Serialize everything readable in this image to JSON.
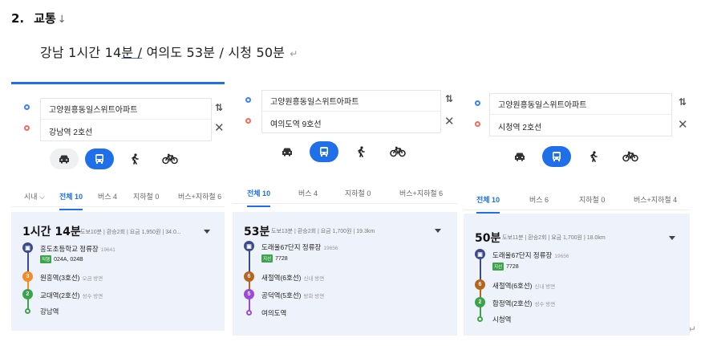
{
  "doc": {
    "heading_num": "2.",
    "heading": "교통",
    "heading_mark": "↓",
    "summary_a": "강남 1시간 14",
    "summary_b": "분 /",
    "summary_c": " 여의도 53분 / 시청 50분",
    "return_mark": "↵"
  },
  "panels": [
    {
      "origin": "고양원흥동일스위트아파트",
      "destination": "강남역 2호선",
      "swap": "⇅",
      "close": "✕",
      "tabs": [
        "시내 ⌵",
        "전체 10",
        "버스 4",
        "지하철 0",
        "버스+지하철 6"
      ],
      "time": "1시간 14분",
      "meta": "도보10분 | 환승2회 | 요금 1,950원 | 34.0...",
      "bus_stop": "흥도초등학교 정류장",
      "bus_stop_id": "19641",
      "bus_chip": "직행",
      "bus_numbers": "024A, 024B",
      "stops": [
        {
          "badge": "3",
          "name": "원흥역(3호선)",
          "dir": "오금 방면"
        },
        {
          "badge": "2",
          "name": "교대역(2호선)",
          "dir": "성수 방면"
        }
      ],
      "end": "강남역"
    },
    {
      "origin": "고양원흥동일스위트아파트",
      "destination": "여의도역 9호선",
      "swap": "⇅",
      "close": "✕",
      "tabs": [
        "전체 10",
        "버스 4",
        "지하철 0",
        "버스+지하철 6"
      ],
      "time": "53분",
      "meta": "도보13분 | 환승2회 | 요금 1,700원 | 19.3km",
      "bus_stop": "도래울67단지 정류장",
      "bus_stop_id": "19656",
      "bus_chip": "지선",
      "bus_numbers": "7728",
      "stops": [
        {
          "badge": "6",
          "name": "새절역(6호선)",
          "dir": "신내 방면"
        },
        {
          "badge": "5",
          "name": "공덕역(5호선)",
          "dir": "방화 방면"
        }
      ],
      "end": "여의도역"
    },
    {
      "origin": "고양원흥동일스위트아파트",
      "destination": "시청역 2호선",
      "swap": "⇅",
      "close": "✕",
      "tabs": [
        "전체 10",
        "버스 6",
        "지하철 0",
        "버스+지하철 4"
      ],
      "time": "50분",
      "meta": "도보11분 | 환승2회 | 요금 1,700원 | 18.0km",
      "bus_stop": "도래울67단지 정류장",
      "bus_stop_id": "19656",
      "bus_chip": "지선",
      "bus_numbers": "7728",
      "stops": [
        {
          "badge": "6",
          "name": "새절역(6호선)",
          "dir": "신내 방면"
        },
        {
          "badge": "2",
          "name": "합정역(2호선)",
          "dir": "성수 방면"
        }
      ],
      "end": "시청역"
    }
  ],
  "modes": [
    "car-icon",
    "bus-icon",
    "walk-icon",
    "bike-icon"
  ],
  "colors": {
    "accent": "#1f6feb",
    "line2": "#3ba34a",
    "line3": "#f28c28",
    "line5": "#9b4ad7",
    "line6": "#b5651d",
    "bus": "#3c4c8a"
  }
}
